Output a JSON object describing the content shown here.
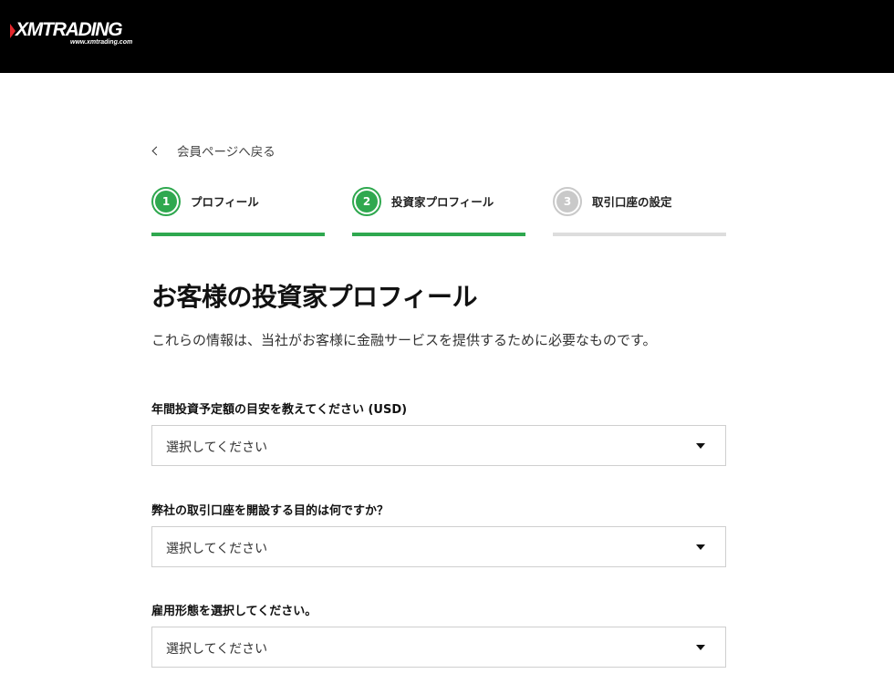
{
  "header": {
    "logo_text": "XMTRADING",
    "logo_url": "www.xmtrading.com"
  },
  "back_link": {
    "label": "会員ページへ戻る"
  },
  "steps": [
    {
      "number": "1",
      "label": "プロフィール",
      "state": "active"
    },
    {
      "number": "2",
      "label": "投資家プロフィール",
      "state": "active"
    },
    {
      "number": "3",
      "label": "取引口座の設定",
      "state": "inactive"
    }
  ],
  "page": {
    "title": "お客様の投資家プロフィール",
    "subtitle": "これらの情報は、当社がお客様に金融サービスを提供するために必要なものです。"
  },
  "fields": [
    {
      "label": "年間投資予定額の目安を教えてください (USD)",
      "value": "選択してください"
    },
    {
      "label": "弊社の取引口座を開設する目的は何ですか？",
      "value": "選択してください"
    },
    {
      "label": "雇用形態を選択してください。",
      "value": "選択してください"
    }
  ],
  "colors": {
    "accent": "#2fa84f",
    "inactive": "#c9c9c9",
    "header_bg": "#000000",
    "logo_mark": "#e3262b"
  }
}
